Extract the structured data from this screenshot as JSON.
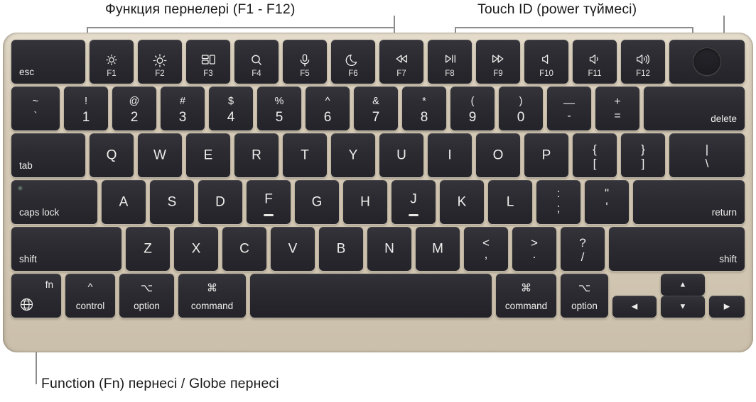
{
  "callouts": {
    "function_keys": "Функция пернелері (F1 - F12)",
    "touch_id": "Touch ID (power түймесі)",
    "fn_globe": "Function (Fn) пернесі / Globe пернесі"
  },
  "colors": {
    "body": "#d6cbb7",
    "key": "#2b2b31",
    "legend": "#efeeec",
    "leader": "#8c8c8c",
    "page": "#ffffff"
  },
  "keyboard": {
    "layout": "US ANSI",
    "rows": {
      "function": [
        {
          "label": "esc",
          "style": "word-left"
        },
        {
          "icon": "brightness-down-icon",
          "flabel": "F1"
        },
        {
          "icon": "brightness-up-icon",
          "flabel": "F2"
        },
        {
          "icon": "mission-control-icon",
          "flabel": "F3"
        },
        {
          "icon": "spotlight-search-icon",
          "flabel": "F4"
        },
        {
          "icon": "dictation-microphone-icon",
          "flabel": "F5"
        },
        {
          "icon": "do-not-disturb-moon-icon",
          "flabel": "F6"
        },
        {
          "icon": "rewind-icon",
          "flabel": "F7"
        },
        {
          "icon": "play-pause-icon",
          "flabel": "F8"
        },
        {
          "icon": "fast-forward-icon",
          "flabel": "F9"
        },
        {
          "icon": "mute-icon",
          "flabel": "F10"
        },
        {
          "icon": "volume-down-icon",
          "flabel": "F11"
        },
        {
          "icon": "volume-up-icon",
          "flabel": "F12"
        },
        {
          "icon": "touch-id-icon",
          "flabel": ""
        }
      ],
      "numbers": [
        {
          "upper": "~",
          "lower": "`"
        },
        {
          "upper": "!",
          "lower": "1"
        },
        {
          "upper": "@",
          "lower": "2"
        },
        {
          "upper": "#",
          "lower": "3"
        },
        {
          "upper": "$",
          "lower": "4"
        },
        {
          "upper": "%",
          "lower": "5"
        },
        {
          "upper": "^",
          "lower": "6"
        },
        {
          "upper": "&",
          "lower": "7"
        },
        {
          "upper": "*",
          "lower": "8"
        },
        {
          "upper": "(",
          "lower": "9"
        },
        {
          "upper": ")",
          "lower": "0"
        },
        {
          "upper": "—",
          "lower": "-"
        },
        {
          "upper": "+",
          "lower": "="
        },
        {
          "label": "delete",
          "style": "word-right"
        }
      ],
      "qwerty": [
        {
          "label": "tab",
          "style": "word-left"
        },
        {
          "single": "Q"
        },
        {
          "single": "W"
        },
        {
          "single": "E"
        },
        {
          "single": "R"
        },
        {
          "single": "T"
        },
        {
          "single": "Y"
        },
        {
          "single": "U"
        },
        {
          "single": "I"
        },
        {
          "single": "O"
        },
        {
          "single": "P"
        },
        {
          "upper": "{",
          "lower": "["
        },
        {
          "upper": "}",
          "lower": "]"
        },
        {
          "upper": "|",
          "lower": "\\"
        }
      ],
      "home": [
        {
          "label": "caps lock",
          "style": "word-left",
          "led": true
        },
        {
          "single": "A"
        },
        {
          "single": "S"
        },
        {
          "single": "D"
        },
        {
          "single": "F",
          "homing": true
        },
        {
          "single": "G"
        },
        {
          "single": "H"
        },
        {
          "single": "J",
          "homing": true
        },
        {
          "single": "K"
        },
        {
          "single": "L"
        },
        {
          "upper": ":",
          "lower": ";"
        },
        {
          "upper": "\"",
          "lower": "'"
        },
        {
          "label": "return",
          "style": "word-right"
        }
      ],
      "shift": [
        {
          "label": "shift",
          "style": "word-left"
        },
        {
          "single": "Z"
        },
        {
          "single": "X"
        },
        {
          "single": "C"
        },
        {
          "single": "V"
        },
        {
          "single": "B"
        },
        {
          "single": "N"
        },
        {
          "single": "M"
        },
        {
          "upper": "<",
          "lower": ","
        },
        {
          "upper": ">",
          "lower": "."
        },
        {
          "upper": "?",
          "lower": "/"
        },
        {
          "label": "shift",
          "style": "word-right"
        }
      ],
      "bottom": [
        {
          "label": "fn",
          "icon": "globe-icon",
          "style": "fn"
        },
        {
          "symbol": "^",
          "label": "control"
        },
        {
          "symbol": "⌥",
          "label": "option"
        },
        {
          "symbol": "⌘",
          "label": "command"
        },
        {
          "label": "",
          "style": "space"
        },
        {
          "symbol": "⌘",
          "label": "command"
        },
        {
          "symbol": "⌥",
          "label": "option"
        },
        {
          "icon": "arrow-left-icon"
        },
        {
          "icon": "arrow-up-icon"
        },
        {
          "icon": "arrow-down-icon"
        },
        {
          "icon": "arrow-right-icon"
        }
      ]
    }
  }
}
